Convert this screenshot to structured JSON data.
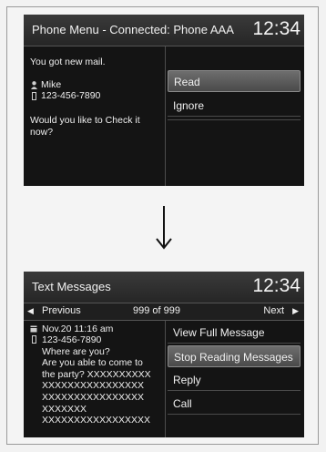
{
  "screen1": {
    "title": "Phone Menu - Connected: Phone AAA",
    "clock": "12:34",
    "message": "You got new mail.",
    "contact_name": "Mike",
    "contact_number": "123-456-7890",
    "question_line1": "Would you like to Check it",
    "question_line2": "now?",
    "options": [
      {
        "label": "Read",
        "selected": true
      },
      {
        "label": "Ignore",
        "selected": false
      }
    ]
  },
  "screen2": {
    "title": "Text Messages",
    "clock": "12:34",
    "nav": {
      "previous": "Previous",
      "counter": "999 of 999",
      "next": "Next"
    },
    "message": {
      "date": "Nov.20 11:16 am",
      "number": "123-456-7890",
      "lines": [
        "Where are you?",
        "Are you able to come to",
        "the party? XXXXXXXXXX",
        "XXXXXXXXXXXXXXXX",
        "XXXXXXXXXXXXXXXX",
        "XXXXXXX",
        "XXXXXXXXXXXXXXXXX"
      ]
    },
    "options": [
      {
        "label": "View Full Message",
        "selected": false
      },
      {
        "label": "Stop Reading Messages",
        "selected": true
      },
      {
        "label": "Reply",
        "selected": false
      },
      {
        "label": "Call",
        "selected": false
      }
    ]
  }
}
